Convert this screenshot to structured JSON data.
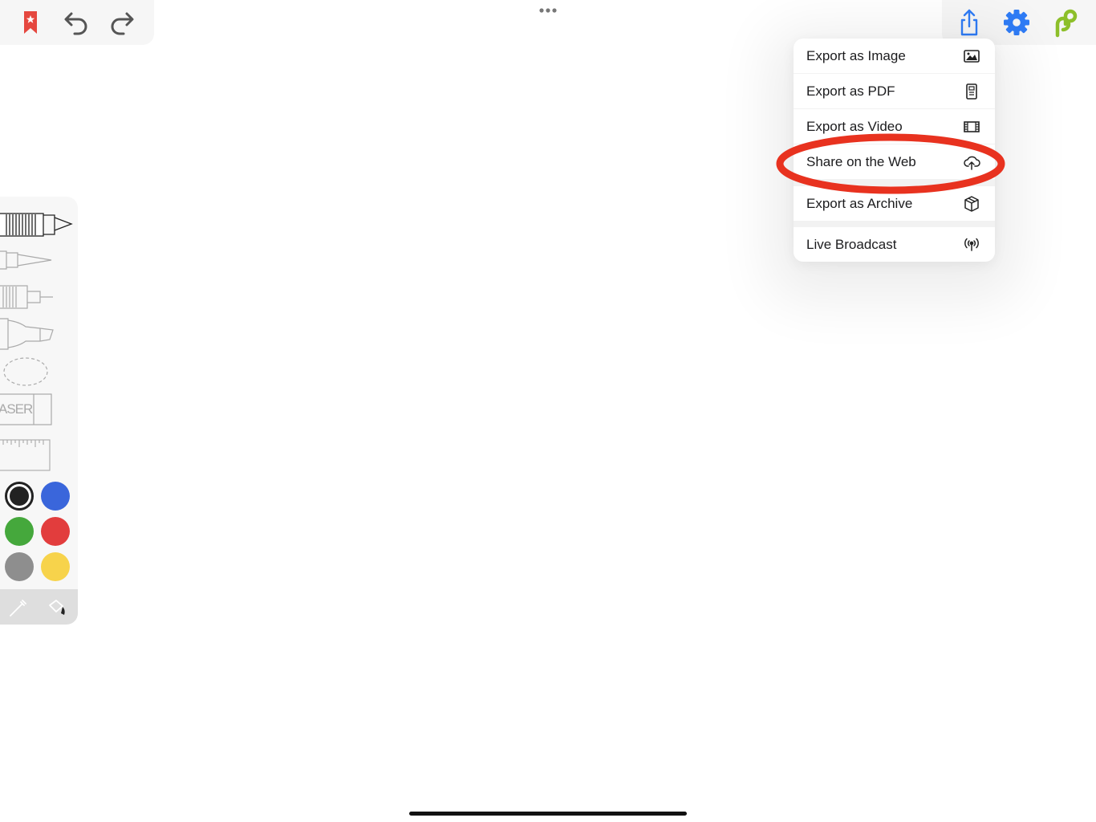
{
  "toolbar_left": {
    "bookmark_icon": "bookmark-star-icon",
    "undo_icon": "undo-icon",
    "redo_icon": "redo-icon"
  },
  "toolbar_center": {
    "more_icon": "ellipsis-icon"
  },
  "toolbar_right": {
    "share_icon": "share-icon",
    "settings_icon": "gear-icon",
    "logo_icon": "app-logo-icon"
  },
  "export_menu": {
    "items": [
      {
        "label": "Export as Image",
        "icon": "image-icon"
      },
      {
        "label": "Export as PDF",
        "icon": "pdf-document-icon"
      },
      {
        "label": "Export as Video",
        "icon": "film-icon"
      },
      {
        "label": "Share on the Web",
        "icon": "cloud-upload-icon",
        "highlighted": true
      },
      {
        "label": "Export as Archive",
        "icon": "box-icon"
      },
      {
        "label": "Live Broadcast",
        "icon": "broadcast-icon"
      }
    ]
  },
  "tools": {
    "items": [
      "pencil",
      "pen",
      "brush",
      "marker",
      "lasso",
      "eraser",
      "ruler"
    ],
    "eraser_label": "ASER",
    "selected": "pencil"
  },
  "colors": {
    "swatches": [
      "#222222",
      "#3a66db",
      "#45a83c",
      "#e23d3d",
      "#8e8e8e",
      "#f7d34b"
    ],
    "selected": "#222222"
  },
  "bottom_tools": {
    "eyedropper_icon": "eyedropper-icon",
    "fill_icon": "paint-bucket-icon"
  },
  "accent": {
    "highlight_oval": "#e8321f",
    "share_blue": "#2f7cf6",
    "logo_green": "#8dbf2a",
    "bookmark_red": "#e5473f"
  }
}
